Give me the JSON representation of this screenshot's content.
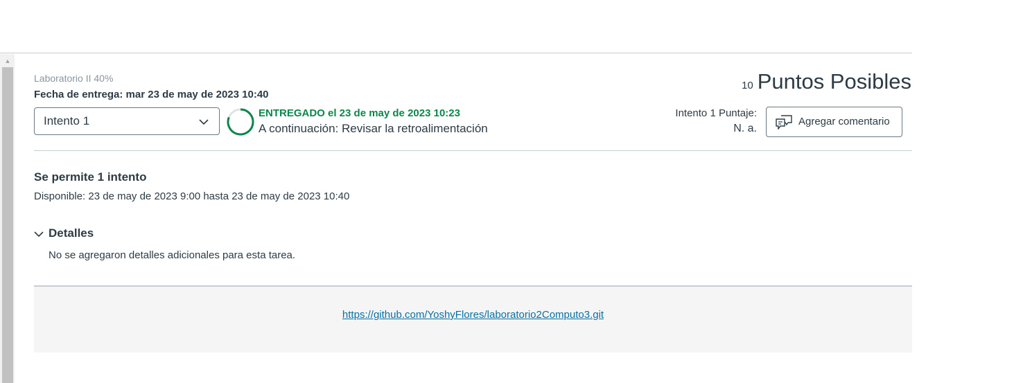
{
  "assignment": {
    "name": "Laboratorio II 40%",
    "due_date": "Fecha de entrega: mar 23 de may de 2023 10:40",
    "points_number": "10",
    "points_label": "Puntos Posibles"
  },
  "attempt_selector": {
    "selected": "Intento 1",
    "icon": "chevron-down-icon"
  },
  "status": {
    "submitted": "ENTREGADO el 23 de may de 2023 10:23",
    "next_step": "A continuación: Revisar la retroalimentación",
    "progress_color": "#0b874b"
  },
  "score": {
    "label": "Intento 1 Puntaje:",
    "value": "N. a."
  },
  "comment_button": {
    "label": "Agregar comentario",
    "icon": "comment-icon"
  },
  "info": {
    "attempts_allowed": "Se permite 1 intento",
    "availability": "Disponible: 23 de may de 2023 9:00 hasta 23 de may de 2023 10:40"
  },
  "details": {
    "title": "Detalles",
    "text": "No se agregaron detalles adicionales para esta tarea."
  },
  "submission": {
    "url": "https://github.com/YoshyFlores/laboratorio2Computo3.git"
  },
  "colors": {
    "success": "#0b874b",
    "link": "#0770a3",
    "text": "#2d3b45"
  }
}
